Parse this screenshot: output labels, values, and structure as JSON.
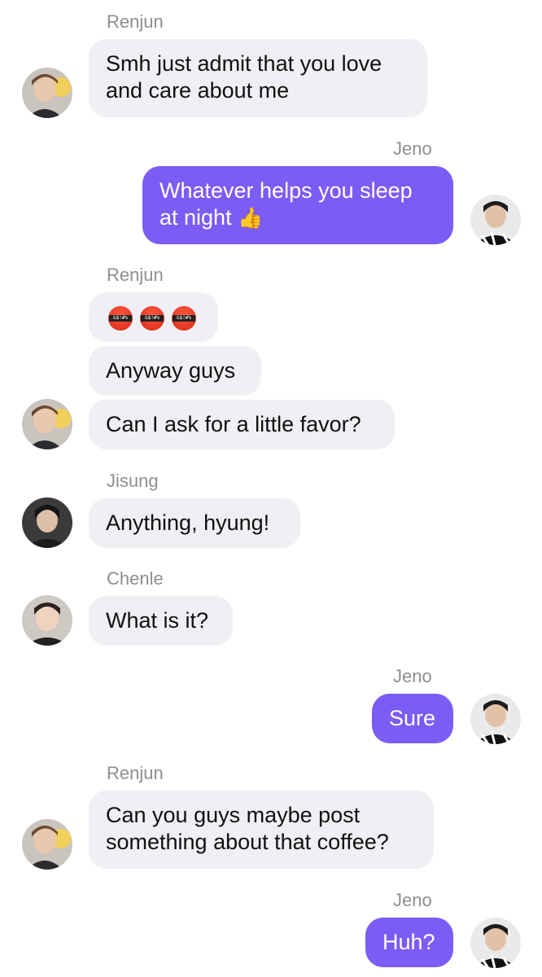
{
  "senders": {
    "renjun": "Renjun",
    "jeno": "Jeno",
    "jisung": "Jisung",
    "chenle": "Chenle"
  },
  "messages": [
    {
      "sender": "Renjun",
      "text_lines": [
        "Smh just admit that you love",
        "and care about me"
      ]
    },
    {
      "sender": "Jeno",
      "text_lines": [
        "Whatever helps you sleep",
        "at night"
      ],
      "emoji": "thumbs-up"
    },
    {
      "sender": "Renjun",
      "emoji_only": [
        "face-with-symbols-on-mouth",
        "face-with-symbols-on-mouth",
        "face-with-symbols-on-mouth"
      ],
      "emoji_text": "&$!#%"
    },
    {
      "sender": "Renjun",
      "text": "Anyway guys"
    },
    {
      "sender": "Renjun",
      "text": "Can I ask for a little favor?"
    },
    {
      "sender": "Jisung",
      "text": "Anything, hyung!"
    },
    {
      "sender": "Chenle",
      "text": "What is it?"
    },
    {
      "sender": "Jeno",
      "text": "Sure"
    },
    {
      "sender": "Renjun",
      "text_lines": [
        "Can you guys maybe post",
        "something about that coffee?"
      ]
    },
    {
      "sender": "Jeno",
      "text": "Huh?"
    }
  ],
  "colors": {
    "outgoing_bubble": "#7b5cf5",
    "incoming_bubble": "#efeff4",
    "name_label": "#8e8e93"
  }
}
